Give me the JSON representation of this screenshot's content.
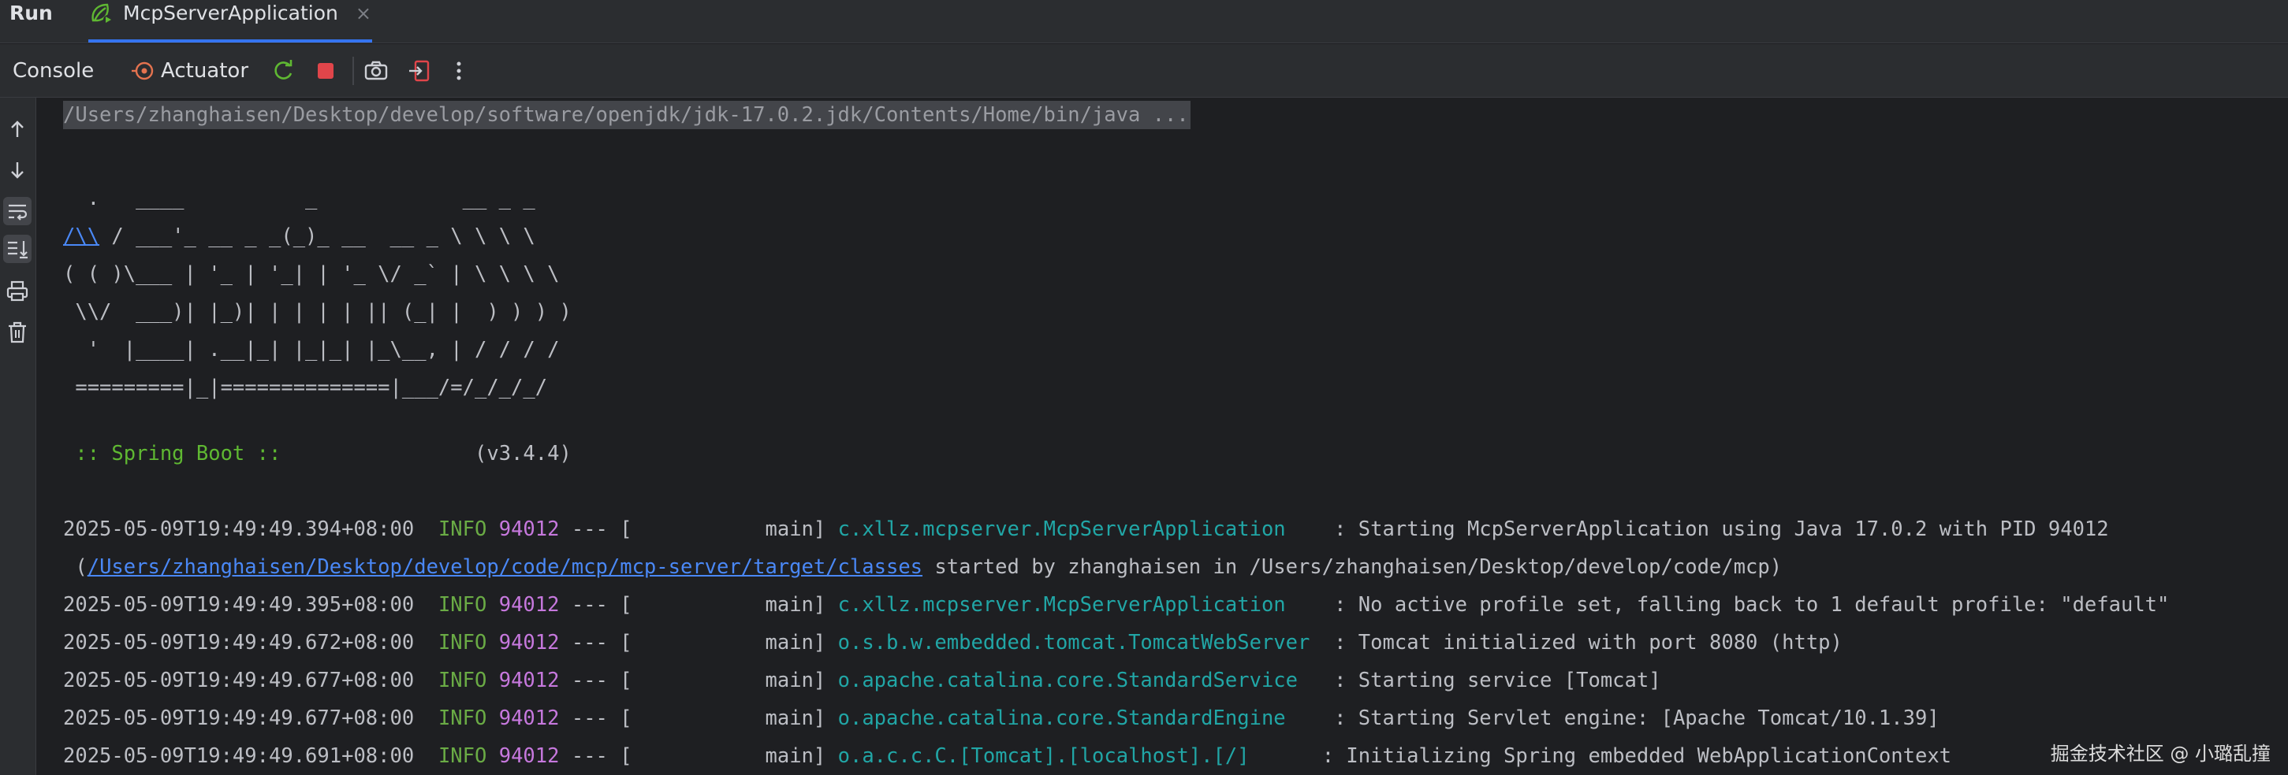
{
  "header": {
    "run_title": "Run",
    "tab_label": "McpServerApplication",
    "tab_close": "×"
  },
  "toolbar": {
    "console_label": "Console",
    "actuator_label": "Actuator",
    "icons": [
      "actuator-icon",
      "rerun-icon",
      "stop-icon",
      "camera-icon",
      "exit-icon",
      "more-icon"
    ]
  },
  "gutter": {
    "icons": [
      "arrow-up-icon",
      "arrow-down-icon",
      "soft-wrap-icon",
      "scroll-to-end-icon",
      "print-icon",
      "trash-icon"
    ]
  },
  "console": {
    "command": "/Users/zhanghaisen/Desktop/develop/software/openjdk/jdk-17.0.2.jdk/Contents/Home/bin/java ...",
    "banner": [
      "  .   ____          _            __ _ _",
      " /\\\\ / ___'_ __ _ _(_)_ __  __ _ \\ \\ \\ \\",
      "( ( )\\___ | '_ | '_| | '_ \\/ _` | \\ \\ \\ \\",
      " \\\\/  ___)| |_)| | | | | || (_| |  ) ) ) )",
      "  '  |____| .__|_| |_|_| |_\\__, | / / / /",
      " =========|_|==============|___/=/_/_/_/"
    ],
    "banner_link": "/\\\\",
    "banner_line2_rest": " / ___'_ __ _ _(_)_ __  __ _ \\ \\ \\ \\",
    "spring_label": " :: Spring Boot :: ",
    "spring_version": "               (v3.4.4)",
    "logs": [
      {
        "ts": "2025-05-09T19:49:49.394+08:00",
        "level": "INFO",
        "pid": "94012",
        "sep": " --- [",
        "thread": "           main]",
        "logger": "c.xllz.mcpserver.McpServerApplication",
        "pad": "    ",
        "msg": ": Starting McpServerApplication using Java 17.0.2 with PID 94012"
      },
      {
        "ts": "2025-05-09T19:49:49.395+08:00",
        "level": "INFO",
        "pid": "94012",
        "sep": " --- [",
        "thread": "           main]",
        "logger": "c.xllz.mcpserver.McpServerApplication",
        "pad": "    ",
        "msg": ": No active profile set, falling back to 1 default profile: \"default\""
      },
      {
        "ts": "2025-05-09T19:49:49.672+08:00",
        "level": "INFO",
        "pid": "94012",
        "sep": " --- [",
        "thread": "           main]",
        "logger": "o.s.b.w.embedded.tomcat.TomcatWebServer",
        "pad": "  ",
        "msg": ": Tomcat initialized with port 8080 (http)"
      },
      {
        "ts": "2025-05-09T19:49:49.677+08:00",
        "level": "INFO",
        "pid": "94012",
        "sep": " --- [",
        "thread": "           main]",
        "logger": "o.apache.catalina.core.StandardService",
        "pad": "   ",
        "msg": ": Starting service [Tomcat]"
      },
      {
        "ts": "2025-05-09T19:49:49.677+08:00",
        "level": "INFO",
        "pid": "94012",
        "sep": " --- [",
        "thread": "           main]",
        "logger": "o.apache.catalina.core.StandardEngine",
        "pad": "    ",
        "msg": ": Starting Servlet engine: [Apache Tomcat/10.1.39]"
      },
      {
        "ts": "2025-05-09T19:49:49.691+08:00",
        "level": "INFO",
        "pid": "94012",
        "sep": " --- [",
        "thread": "           main]",
        "logger": "o.a.c.c.C.[Tomcat].[localhost].[/]",
        "pad": "      ",
        "msg": ": Initializing Spring embedded WebApplicationContext"
      }
    ],
    "continuation_open": " (",
    "continuation_link": "/Users/zhanghaisen/Desktop/develop/code/mcp/mcp-server/target/classes",
    "continuation_rest": " started by zhanghaisen in /Users/zhanghaisen/Desktop/develop/code/mcp)"
  },
  "watermark": "掘金技术社区 @ 小璐乱撞"
}
